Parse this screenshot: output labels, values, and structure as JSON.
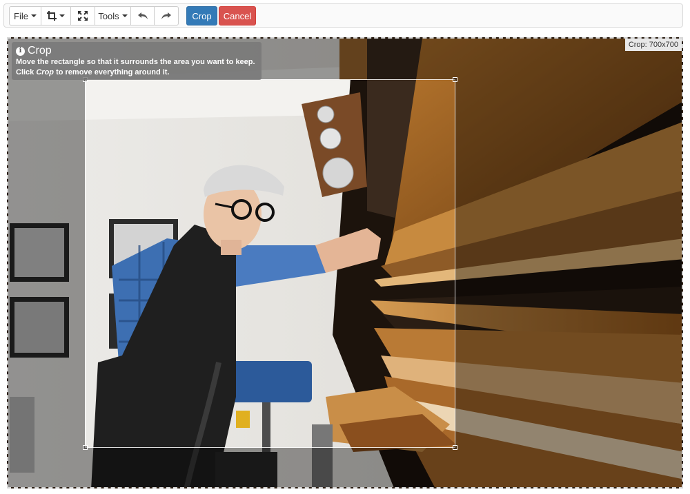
{
  "toolbar": {
    "file_label": "File",
    "crop_tool_icon": "crop-icon",
    "fit_icon": "fit-to-screen-icon",
    "tools_label": "Tools",
    "undo_icon": "undo-arrow-icon",
    "redo_icon": "redo-arrow-icon",
    "crop_label": "Crop",
    "cancel_label": "Cancel",
    "crop_color": "#337ab7",
    "cancel_color": "#d9534f"
  },
  "tooltip": {
    "title": "Crop",
    "line1": "Move the rectangle so that it surrounds the area you want to keep.",
    "line2_pre": "Click ",
    "line2_em": "Crop",
    "line2_post": " to remove everything around it."
  },
  "crop_info": "Crop: 700x700",
  "photo": {
    "subject": "woodworker in flat cap and blue plaid shirt pulling veneer sheets from a shelf"
  }
}
